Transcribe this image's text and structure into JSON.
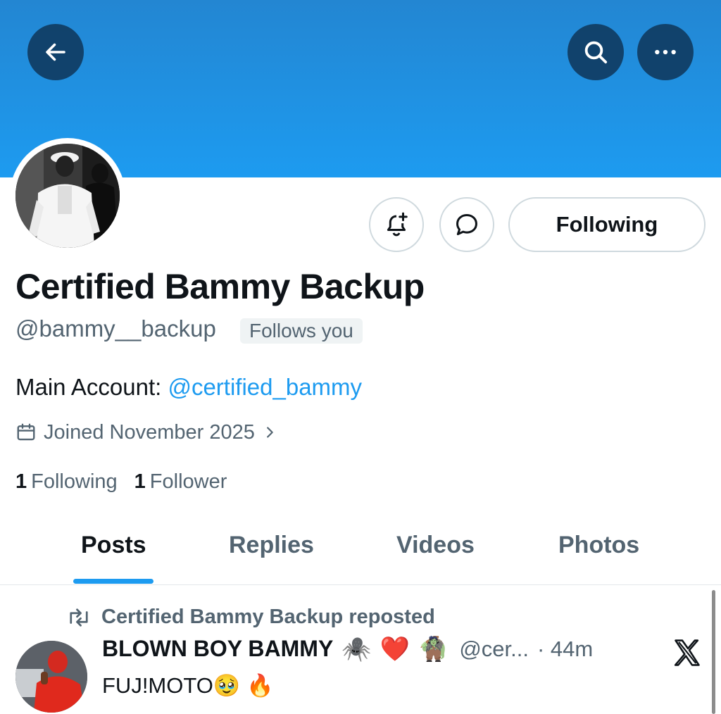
{
  "header": {
    "banner_color": "#1d9bf0",
    "back_icon": "arrow-left-icon",
    "search_icon": "search-icon",
    "more_icon": "more-horizontal-icon"
  },
  "profile": {
    "display_name": "Certified Bammy Backup",
    "handle": "@bammy__backup",
    "follows_you_badge": "Follows you",
    "bio_prefix": "Main Account: ",
    "bio_mention": "@certified_bammy",
    "joined": "Joined November 2025",
    "following_count": "1",
    "following_label": "Following",
    "followers_count": "1",
    "followers_label": "Follower"
  },
  "actions": {
    "notify_icon": "bell-plus-icon",
    "message_icon": "message-bubble-icon",
    "following_button": "Following"
  },
  "tabs": [
    {
      "label": "Posts",
      "active": true
    },
    {
      "label": "Replies",
      "active": false
    },
    {
      "label": "Videos",
      "active": false
    },
    {
      "label": "Photos",
      "active": false
    }
  ],
  "post": {
    "repost_label": "Certified Bammy Backup reposted",
    "author": "BLOWN BOY BAMMY",
    "author_emojis": [
      "🕷️",
      "❤️",
      "🧌"
    ],
    "handle": "@cer...",
    "time": "· 44m",
    "text": "FUJ!MOTO🥹 🔥"
  },
  "colors": {
    "accent": "#1d9bf0",
    "secondary_text": "#536471",
    "primary_text": "#0f1419"
  }
}
